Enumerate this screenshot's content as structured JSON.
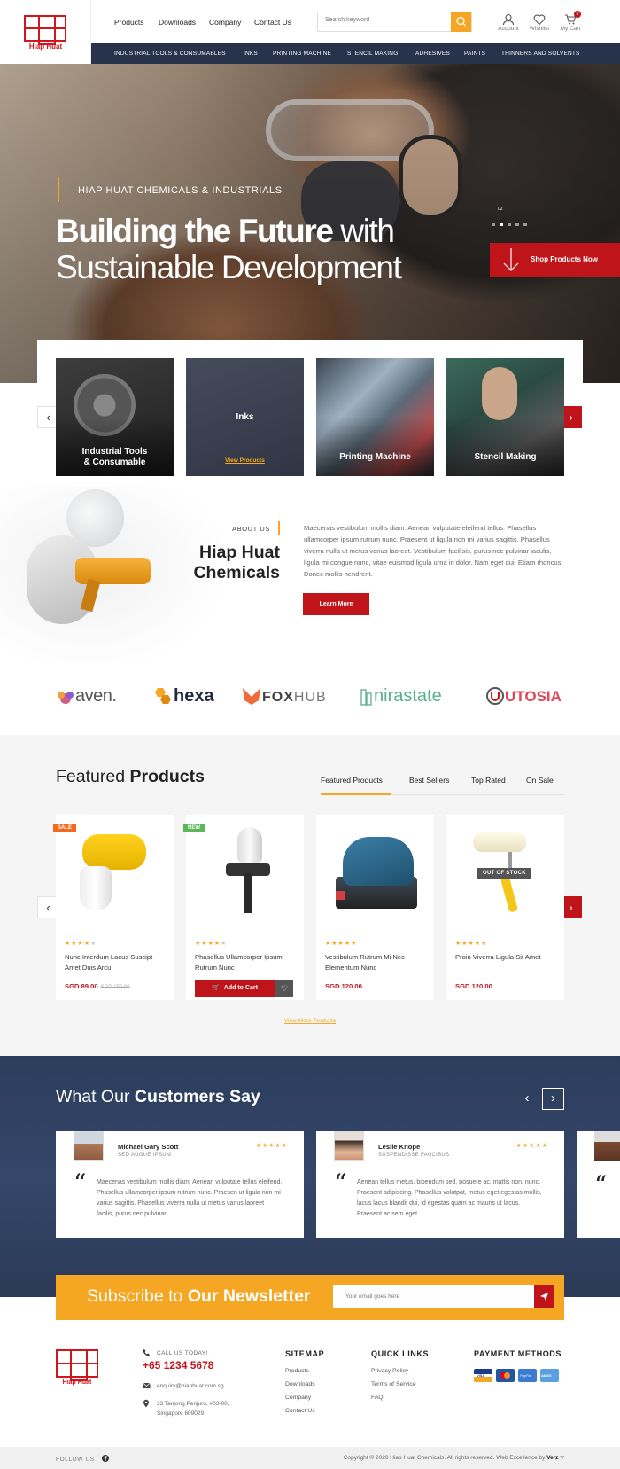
{
  "header": {
    "logo_text": "Hiap Huat",
    "nav": [
      "Products",
      "Downloads",
      "Company",
      "Contact Us"
    ],
    "search_placeholder": "Search keyword",
    "account": "Account",
    "wishlist": "Wishlist",
    "cart": "My Cart",
    "cart_count": "0"
  },
  "categories": [
    "INDUSTRIAL TOOLS & CONSUMABLES",
    "INKS",
    "PRINTING MACHINE",
    "STENCIL MAKING",
    "ADHESIVES",
    "PAINTS",
    "THINNERS AND SOLVENTS"
  ],
  "hero": {
    "kicker": "HIAP HUAT CHEMICALS & INDUSTRIALS",
    "title_bold": "Building the Future",
    "title_rest": " with",
    "title_line2": "Sustainable Development",
    "slide_number": "02",
    "cta": "Shop Products Now"
  },
  "category_cards": [
    {
      "label_line1": "Industrial Tools",
      "label_line2": "& Consumable"
    },
    {
      "label_line1": "Inks",
      "link": "View Products"
    },
    {
      "label_line1": "Printing Machine"
    },
    {
      "label_line1": "Stencil Making"
    }
  ],
  "about": {
    "kicker": "ABOUT US",
    "title_line1": "Hiap Huat",
    "title_line2": "Chemicals",
    "text": "Maecenas vestibulum mollis diam. Aenean vulputate eleifend tellus. Phasellus ullamcorper ipsum rutrum nunc. Praesent ut ligula non mi varius sagittis. Phasellus viverra nulla ut metus varius laoreet. Vestibulum facilisis, purus nec pulvinar iaculis, ligula mi congue nunc, vitae euismod ligula urna in dolor. Nam eget dui. Etiam rhoncus. Donec mollis hendrerit.",
    "button": "Learn More"
  },
  "brands": [
    "aven.",
    "hexa",
    "FOX",
    "HUB",
    "nirastate",
    "UTOSIA"
  ],
  "featured": {
    "title_light": "Featured ",
    "title_bold": "Products",
    "tabs": [
      "Featured Products",
      "Best Sellers",
      "Top Rated",
      "On Sale"
    ],
    "products": [
      {
        "badge": "SALE",
        "name": "Nunc Interdum Lacus Suscipt Amet Duis Arcu",
        "price": "SGD 89.00",
        "old_price": "SGD 150.00",
        "rating": 4
      },
      {
        "badge": "NEW",
        "name": "Phasellus Ullamcorper Ipsum Rutrum Nunc",
        "price": "",
        "add_to_cart": "Add to Cart",
        "rating": 4
      },
      {
        "name": "Vestibulum Rutrum Mi Nec Elementum Nunc",
        "price": "SGD 120.00",
        "rating": 5
      },
      {
        "name": "Proin Viverra Ligula Sit Amet",
        "price": "SGD 120.00",
        "stock_label": "OUT OF STOCK",
        "rating": 5
      }
    ],
    "view_more": "View More Products"
  },
  "testimonials": {
    "title_light": "What Our ",
    "title_bold": "Customers Say",
    "items": [
      {
        "name": "Michael Gary Scott",
        "role": "SED AUGUE IPSUM",
        "text": "Maecenas vestibulum mollis diam. Aenean vulputate tellus eleifend. Phasellus ullamcorper ipsum rutrum nunc. Praesen ut ligula non mi varius sagittis. Phasellus viverra nulla ut metus varius laoreet facilis, purus nec pulvinar."
      },
      {
        "name": "Leslie Knope",
        "role": "SUSPENDISSE FAUCIBUS",
        "text": "Aenean tellus metus, bibendum sed, posuere ac, mattis non, nunc. Praesent adipiscing. Phasellus volutpat, metus eget egestas mollis, lacus lacus blandit dui, id egestas quam ac mauris ut lacus. Praesent ac sem eget."
      }
    ]
  },
  "newsletter": {
    "title_light": "Subscribe to ",
    "title_bold": "Our Newsletter",
    "placeholder": "Your email goes here"
  },
  "footer": {
    "logo_text": "Hiap Huat",
    "call_label": "CALL US TODAY!",
    "phone": "+65 1234 5678",
    "email": "enquiry@hiaphuat.com.sg",
    "address_line1": "33 Tanjong Penjuru, #03-00,",
    "address_line2": "Singapore 609029",
    "sitemap_title": "SITEMAP",
    "sitemap": [
      "Products",
      "Downloads",
      "Company",
      "Contact Us"
    ],
    "quick_title": "QUICK LINKS",
    "quick": [
      "Privacy Policy",
      "Terms of Service",
      "FAQ"
    ],
    "payment_title": "PAYMENT METHODS",
    "payment": [
      "VISA",
      "MC",
      "PayPal",
      "AMEX"
    ],
    "follow": "FOLLOW US",
    "copyright": "Copyright © 2020 Hiap Huat Chemicals. All rights reserved. Web Excellence by",
    "credit": "Verz"
  },
  "colors": {
    "red": "#c0141b",
    "orange": "#f5a623",
    "navy": "#27334a"
  }
}
